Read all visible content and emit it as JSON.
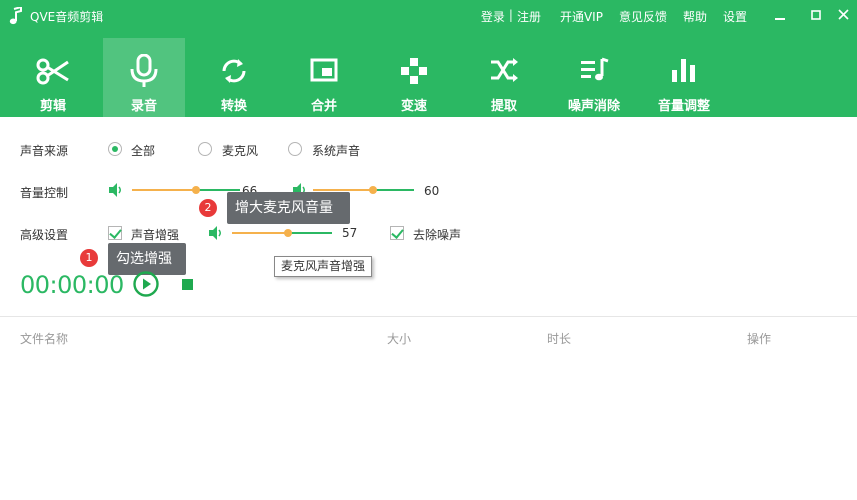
{
  "app": {
    "title": "QVE音频剪辑"
  },
  "top_links": {
    "login": "登录",
    "sep": "|",
    "register": "注册",
    "vip": "开通VIP",
    "feedback": "意见反馈",
    "help": "帮助",
    "settings": "设置"
  },
  "toolbar": {
    "items": [
      {
        "label": "剪辑",
        "icon": "scissors-icon",
        "active": false
      },
      {
        "label": "录音",
        "icon": "microphone-icon",
        "active": true
      },
      {
        "label": "转换",
        "icon": "convert-icon",
        "active": false
      },
      {
        "label": "合并",
        "icon": "merge-icon",
        "active": false
      },
      {
        "label": "变速",
        "icon": "speed-icon",
        "active": false
      },
      {
        "label": "提取",
        "icon": "extract-icon",
        "active": false
      },
      {
        "label": "噪声消除",
        "icon": "noise-removal-icon",
        "active": false
      },
      {
        "label": "音量调整",
        "icon": "volume-bars-icon",
        "active": false
      }
    ]
  },
  "source": {
    "label": "声音来源",
    "options": [
      {
        "label": "全部",
        "checked": true
      },
      {
        "label": "麦克风",
        "checked": false
      },
      {
        "label": "系统声音",
        "checked": false
      }
    ]
  },
  "volume": {
    "label": "音量控制",
    "mic_value": "66",
    "system_value": "60"
  },
  "advanced": {
    "label": "高级设置",
    "enhance_label": "声音增强",
    "enhance_checked": true,
    "enhance_value": "57",
    "denoise_label": "去除噪声",
    "denoise_checked": true,
    "tooltip": "麦克风声音增强"
  },
  "callouts": {
    "one_badge": "1",
    "one_text": "勾选增强",
    "two_badge": "2",
    "two_text": "增大麦克风音量"
  },
  "recorder": {
    "timer": "00:00:00"
  },
  "file_table": {
    "columns": [
      "文件名称",
      "大小",
      "时长",
      "操作"
    ]
  },
  "colors": {
    "brand": "#2bb863",
    "slider_accent": "#f5b14c",
    "badge": "#e83a3a"
  }
}
